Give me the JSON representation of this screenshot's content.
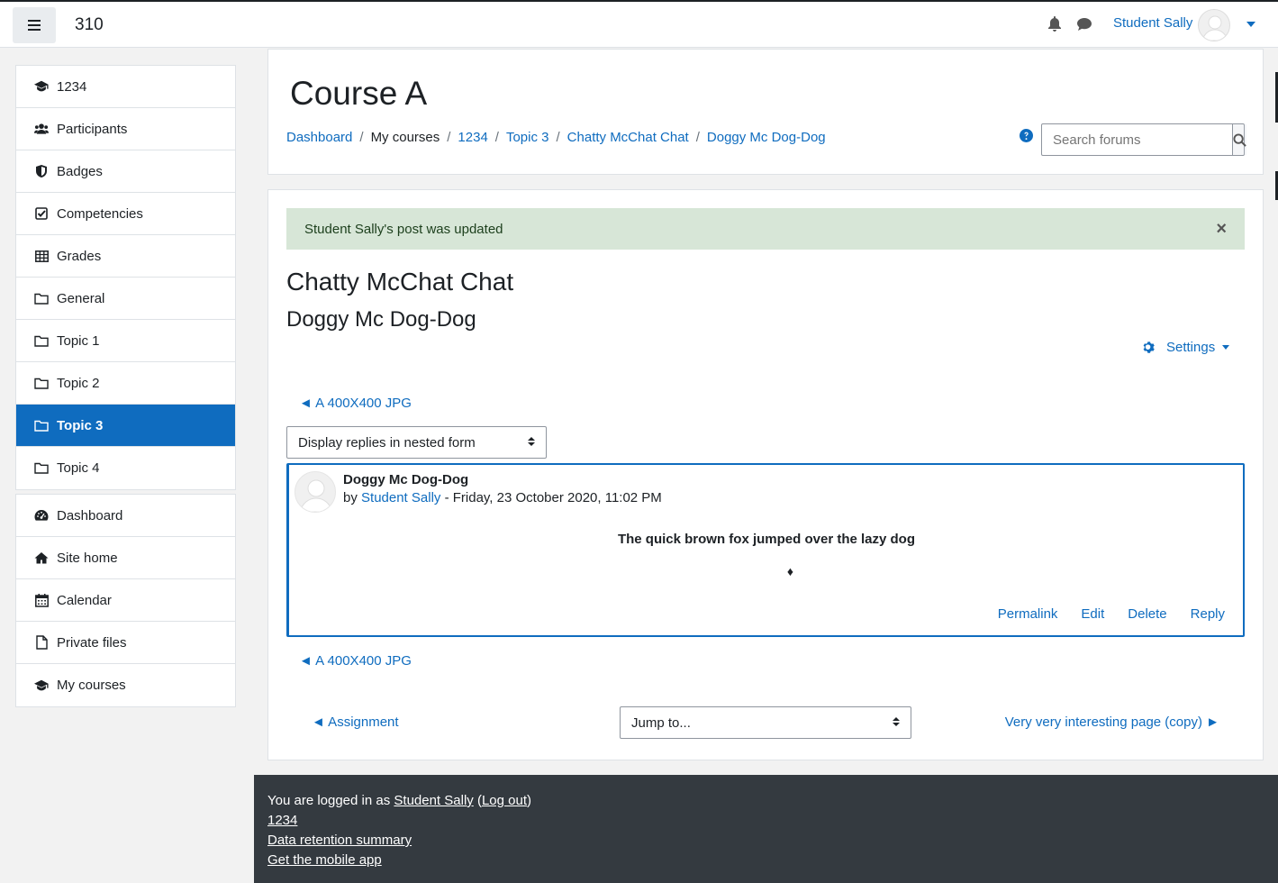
{
  "navbar": {
    "site_name": "310",
    "user_name": "Student Sally"
  },
  "sidebar": {
    "course_items": [
      {
        "label": "1234",
        "icon": "graduation-cap-icon"
      },
      {
        "label": "Participants",
        "icon": "users-icon"
      },
      {
        "label": "Badges",
        "icon": "shield-icon"
      },
      {
        "label": "Competencies",
        "icon": "check-square-icon"
      },
      {
        "label": "Grades",
        "icon": "table-icon"
      },
      {
        "label": "General",
        "icon": "folder-icon"
      },
      {
        "label": "Topic 1",
        "icon": "folder-icon"
      },
      {
        "label": "Topic 2",
        "icon": "folder-icon"
      },
      {
        "label": "Topic 3",
        "icon": "folder-icon",
        "active": true
      },
      {
        "label": "Topic 4",
        "icon": "folder-icon"
      }
    ],
    "site_items": [
      {
        "label": "Dashboard",
        "icon": "dashboard-icon"
      },
      {
        "label": "Site home",
        "icon": "home-icon"
      },
      {
        "label": "Calendar",
        "icon": "calendar-icon"
      },
      {
        "label": "Private files",
        "icon": "file-icon"
      },
      {
        "label": "My courses",
        "icon": "graduation-cap-icon"
      }
    ]
  },
  "header": {
    "course_title": "Course A",
    "breadcrumb": [
      "Dashboard",
      "My courses",
      "1234",
      "Topic 3",
      "Chatty McChat Chat",
      "Doggy Mc Dog-Dog"
    ],
    "search_placeholder": "Search forums"
  },
  "main": {
    "alert_text": "Student Sally's post was updated",
    "alert_close": "×",
    "forum_title": "Chatty McChat Chat",
    "discussion_title": "Doggy Mc Dog-Dog",
    "settings_label": "Settings",
    "prev_discussion": "◄ A 400X400 JPG",
    "display_mode": "Display replies in nested form",
    "post": {
      "subject": "Doggy Mc Dog-Dog",
      "by": "by",
      "author": "Student Sally",
      "date": " - Friday, 23 October 2020, 11:02 PM",
      "body": "The quick brown fox jumped over the lazy dog",
      "diamond": "♦",
      "actions": [
        "Permalink",
        "Edit",
        "Delete",
        "Reply"
      ]
    },
    "prev_activity": "◄ Assignment",
    "jump_to": "Jump to...",
    "next_activity": "Very very interesting page (copy) ►"
  },
  "footer": {
    "logged_in_prefix": "You are logged in as ",
    "user": "Student Sally",
    "open_paren": " (",
    "logout": "Log out",
    "close_paren": ")",
    "course_link": "1234",
    "data_retention": "Data retention summary",
    "mobile_app": "Get the mobile app"
  }
}
